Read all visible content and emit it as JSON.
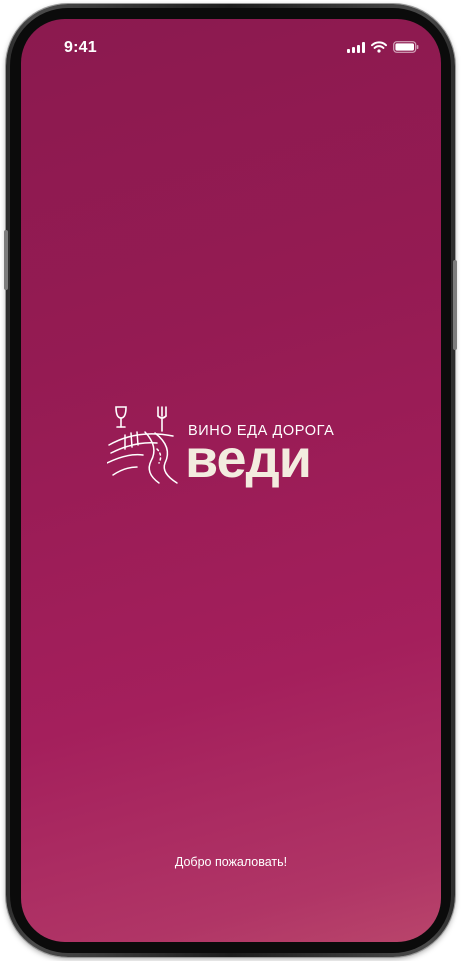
{
  "status_bar": {
    "time": "9:41",
    "icons": [
      "signal-icon",
      "wifi-icon",
      "battery-icon"
    ]
  },
  "logo": {
    "tagline": "ВИНО ЕДА ДОРОГА",
    "wordmark": "веди",
    "emblem_icons": [
      "wine-glass-icon",
      "fork-icon",
      "road-icon"
    ],
    "colors": {
      "tagline": "#ffffff",
      "wordmark": "#f3ecdf"
    }
  },
  "welcome_text": "Добро пожаловать!",
  "colors": {
    "background_top": "#8b1a4f",
    "background_bottom": "#b9456b"
  }
}
